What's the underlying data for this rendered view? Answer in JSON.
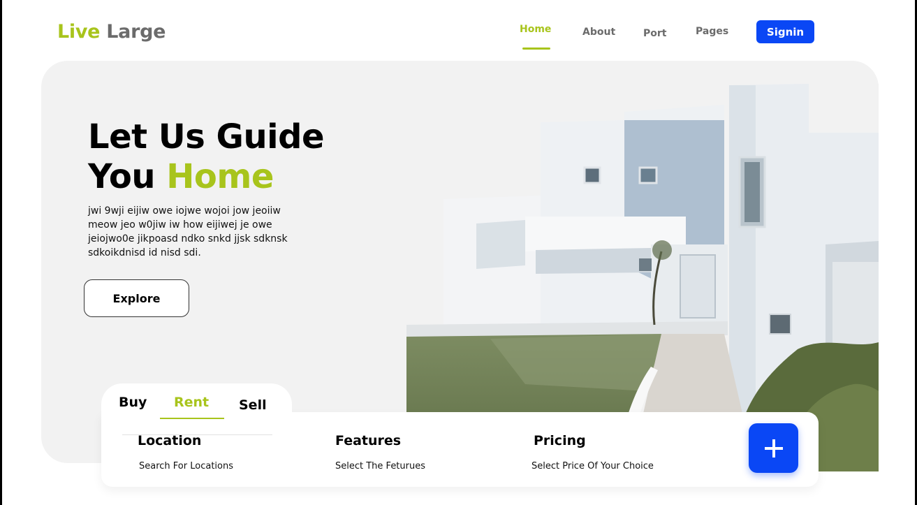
{
  "logo": {
    "part1": "Live",
    "part2": "Large"
  },
  "nav": {
    "home": "Home",
    "about": "About",
    "port": "Port",
    "pages": "Pages",
    "signin": "Signin"
  },
  "hero": {
    "headline_line1": "Let Us Guide",
    "headline_line2_a": "You",
    "headline_line2_b": "Home",
    "description": "jwi 9wji eijiw owe iojwe wojoi jow jeoiiw meow jeo w0jiw iw how eijiwej je owe jeiojwo0e jikpoasd ndko snkd jjsk sdknsk sdkoikdnisd id nisd sdi.",
    "explore_label": "Explore"
  },
  "search": {
    "tabs": [
      "Buy",
      "Rent",
      "Sell"
    ],
    "active_tab": "Rent",
    "fields": [
      {
        "title": "Location",
        "subtitle": "Search For  Locations"
      },
      {
        "title": "Features",
        "subtitle": "Select The Feturues"
      },
      {
        "title": "Pricing",
        "subtitle": "Select Price Of Your Choice"
      }
    ],
    "add_icon": "plus-icon"
  },
  "colors": {
    "accent": "#a8c41c",
    "primary": "#0a47f5",
    "muted": "#6b6b6b",
    "hero_bg": "#f2f2f2"
  }
}
